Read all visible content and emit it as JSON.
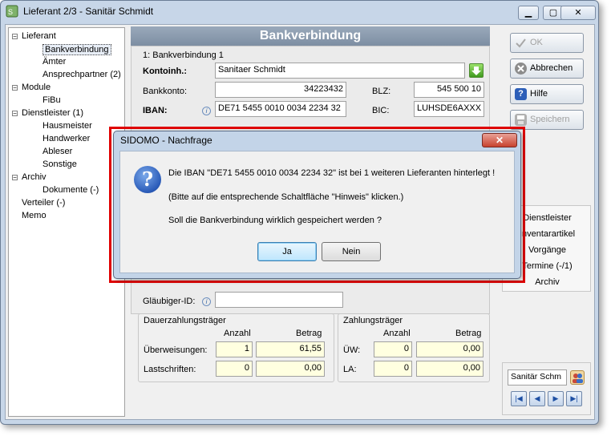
{
  "window": {
    "title": "Lieferant 2/3 - Sanitär Schmidt",
    "min": "▁",
    "max": "▢",
    "close": "✕"
  },
  "tree": [
    {
      "label": "Lieferant",
      "box": "−",
      "level": 0
    },
    {
      "label": "Bankverbindung",
      "level": 1,
      "selected": true
    },
    {
      "label": "Ämter",
      "level": 1
    },
    {
      "label": "Ansprechpartner (2)",
      "level": 1
    },
    {
      "label": "Module",
      "box": "−",
      "level": 0
    },
    {
      "label": "FiBu",
      "level": 1
    },
    {
      "label": "Dienstleister (1)",
      "box": "−",
      "level": 0
    },
    {
      "label": "Hausmeister",
      "level": 1
    },
    {
      "label": "Handwerker",
      "level": 1
    },
    {
      "label": "Ableser",
      "level": 1
    },
    {
      "label": "Sonstige",
      "level": 1
    },
    {
      "label": "Archiv",
      "box": "−",
      "level": 0
    },
    {
      "label": "Dokumente (-)",
      "level": 1
    },
    {
      "label": "Verteiler (-)",
      "level": 0
    },
    {
      "label": "Memo",
      "level": 0
    }
  ],
  "header": "Bankverbindung",
  "form": {
    "section_label": "1: Bankverbindung 1",
    "kontoinh_label": "Kontoinh.:",
    "kontoinh_value": "Sanitaer Schmidt",
    "bankkonto_label": "Bankkonto:",
    "bankkonto_value": "34223432",
    "blz_label": "BLZ:",
    "blz_value": "545 500 10",
    "iban_label": "IBAN:",
    "iban_value": "DE71 5455 0010 0034 2234 32",
    "bic_label": "BIC:",
    "bic_value": "LUHSDE6AXXX",
    "info_glyph": "i",
    "glaeubiger_label": "Gläubiger-ID:",
    "glaeubiger_value": ""
  },
  "dauer": {
    "title": "Dauerzahlungsträger",
    "col_anzahl": "Anzahl",
    "col_betrag": "Betrag",
    "rows": [
      {
        "label": "Überweisungen:",
        "anzahl": "1",
        "betrag": "61,55"
      },
      {
        "label": "Lastschriften:",
        "anzahl": "0",
        "betrag": "0,00"
      }
    ]
  },
  "zahl": {
    "title": "Zahlungsträger",
    "col_anzahl": "Anzahl",
    "col_betrag": "Betrag",
    "rows": [
      {
        "label": "ÜW:",
        "anzahl": "0",
        "betrag": "0,00"
      },
      {
        "label": "LA:",
        "anzahl": "0",
        "betrag": "0,00"
      }
    ]
  },
  "buttons": {
    "ok": "OK",
    "abbrechen": "Abbrechen",
    "hilfe": "Hilfe",
    "speichern": "Speichern"
  },
  "right_list": [
    "Dienstleister",
    "Inventarartikel",
    "Vorgänge",
    "Termine (-/1)",
    "Archiv"
  ],
  "nav": {
    "name": "Sanitär Schm",
    "first": "|◀",
    "prev": "◀",
    "next": "▶",
    "last": "▶|"
  },
  "dialog": {
    "title": "SIDOMO - Nachfrage",
    "close": "✕",
    "icon": "?",
    "line1": "Die IBAN \"DE71 5455 0010 0034 2234 32\" ist bei 1 weiteren Lieferanten hinterlegt !",
    "line2": "(Bitte auf die entsprechende Schaltfläche \"Hinweis\" klicken.)",
    "line3": "Soll die Bankverbindung wirklich gespeichert werden ?",
    "yes": "Ja",
    "no": "Nein"
  },
  "colors": {
    "highlight": "#e00000",
    "accent": "#2a5bb8",
    "header": "#8797ab"
  }
}
